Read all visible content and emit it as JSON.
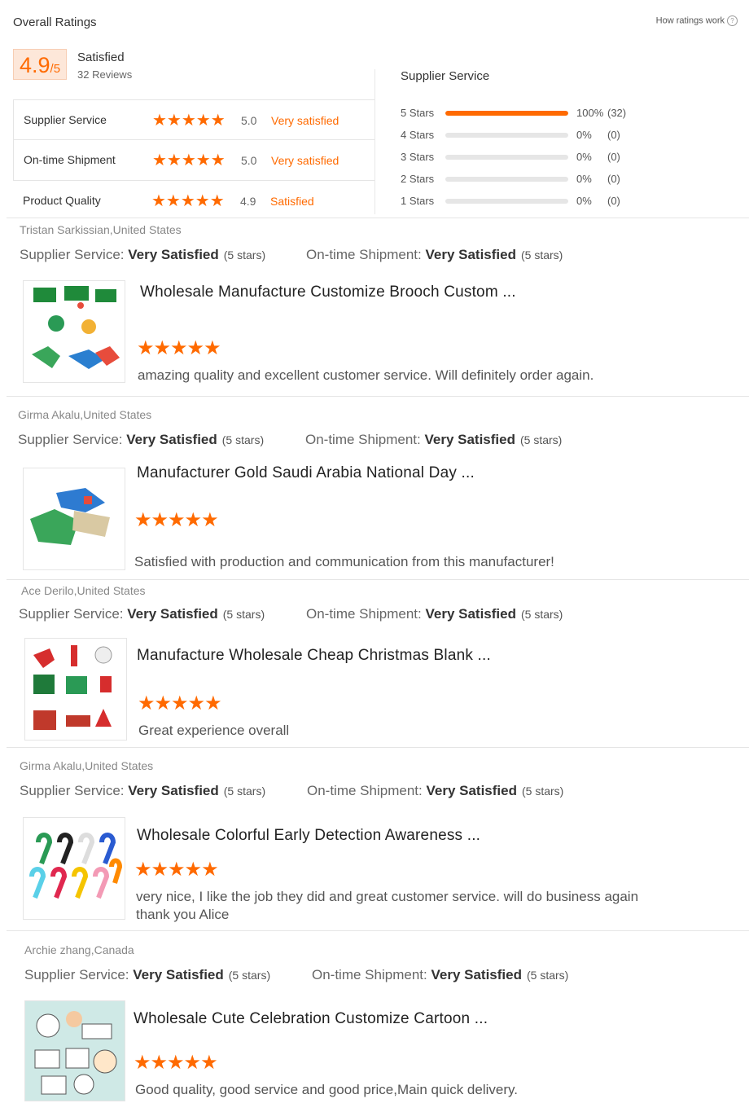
{
  "header": {
    "title": "Overall Ratings",
    "how_link": "How ratings work",
    "how_icon": "question-circle-icon"
  },
  "summary": {
    "score": "4.9",
    "out_of": "/5",
    "label": "Satisfied",
    "reviews": "32 Reviews"
  },
  "categories": [
    {
      "label": "Supplier Service",
      "stars": "★★★★★",
      "score": "5.0",
      "desc": "Very satisfied"
    },
    {
      "label": "On-time Shipment",
      "stars": "★★★★★",
      "score": "5.0",
      "desc": "Very satisfied"
    },
    {
      "label": "Product Quality",
      "stars": "★★★★★",
      "score": "4.9",
      "desc": "Satisfied"
    }
  ],
  "distribution": {
    "title": "Supplier Service",
    "rows": [
      {
        "label": "5 Stars",
        "fraction": 1.0,
        "pct": "100%",
        "count": "(32)"
      },
      {
        "label": "4 Stars",
        "fraction": 0.0,
        "pct": "0%",
        "count": "(0)"
      },
      {
        "label": "3 Stars",
        "fraction": 0.0,
        "pct": "0%",
        "count": "(0)"
      },
      {
        "label": "2 Stars",
        "fraction": 0.0,
        "pct": "0%",
        "count": "(0)"
      },
      {
        "label": "1 Stars",
        "fraction": 0.0,
        "pct": "0%",
        "count": "(0)"
      }
    ]
  },
  "colors": {
    "accent": "#ff6a00",
    "accent_bg": "#fde7d9"
  },
  "reviews": [
    {
      "who": "Tristan Sarkissian,United States",
      "svc_label": "Supplier Service:",
      "svc_val": "Very Satisfied",
      "svc_stars": "(5 stars)",
      "ship_label": "On-time Shipment:",
      "ship_val": "Very Satisfied",
      "ship_stars": "(5 stars)",
      "title": "Wholesale Manufacture Customize Brooch Custom  ...",
      "stars": "★★★★★",
      "comment": "amazing quality and excellent customer service. Will definitely order again.",
      "image": "saudi-flag-pins"
    },
    {
      "who": "Girma Akalu,United States",
      "svc_label": "Supplier Service:",
      "svc_val": "Very Satisfied",
      "svc_stars": "(5 stars)",
      "ship_label": "On-time Shipment:",
      "ship_val": "Very Satisfied",
      "ship_stars": "(5 stars)",
      "title": "Manufacturer Gold Saudi Arabia National Day  ...",
      "stars": "★★★★★",
      "comment": "Satisfied with production and communication from this manufacturer!",
      "image": "saudi-map-pins"
    },
    {
      "who": "Ace Derilo,United States",
      "svc_label": "Supplier Service:",
      "svc_val": "Very Satisfied",
      "svc_stars": "(5 stars)",
      "ship_label": "On-time Shipment:",
      "ship_val": "Very Satisfied",
      "ship_stars": "(5 stars)",
      "title": "Manufacture Wholesale Cheap Christmas Blank ...",
      "stars": "★★★★★",
      "comment": "Great experience overall",
      "image": "christmas-pins"
    },
    {
      "who": "Girma Akalu,United States",
      "svc_label": "Supplier Service:",
      "svc_val": "Very Satisfied",
      "svc_stars": "(5 stars)",
      "ship_label": "On-time Shipment:",
      "ship_val": "Very Satisfied",
      "ship_stars": "(5 stars)",
      "title": "Wholesale Colorful Early Detection Awareness ...",
      "stars": "★★★★★",
      "comment": "very nice, I like the job they did and great customer service. will do business again thank you Alice",
      "image": "awareness-ribbon-pins"
    },
    {
      "who": "Archie zhang,Canada",
      "svc_label": "Supplier Service:",
      "svc_val": "Very Satisfied",
      "svc_stars": "(5 stars)",
      "ship_label": "On-time Shipment:",
      "ship_val": "Very Satisfied",
      "ship_stars": "(5 stars)",
      "title": "Wholesale Cute Celebration Customize Cartoon ...",
      "stars": "★★★★★",
      "comment": "Good quality, good service and good price,Main quick delivery.",
      "image": "cartoon-cat-pins"
    }
  ]
}
